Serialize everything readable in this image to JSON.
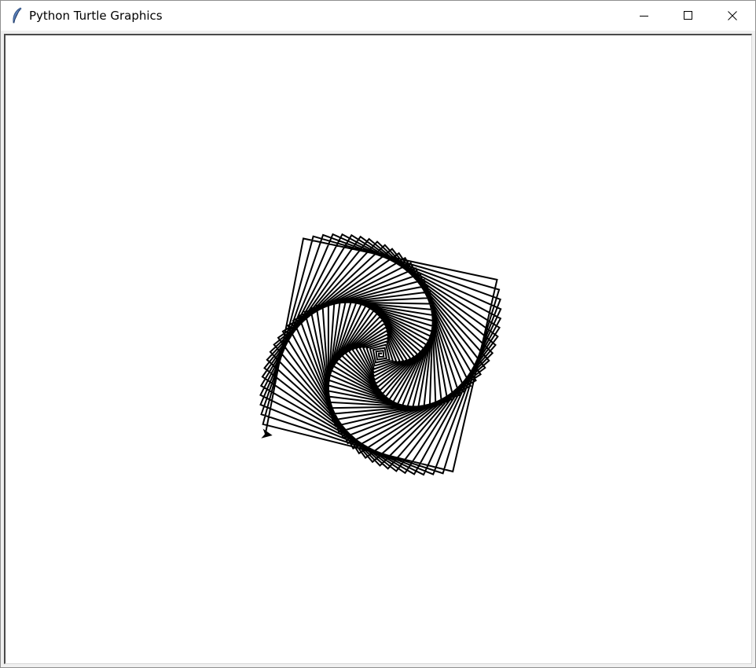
{
  "window": {
    "title": "Python Turtle Graphics",
    "app_icon": "feather-icon",
    "controls": {
      "minimize_icon": "minimize-icon",
      "maximize_icon": "maximize-icon",
      "close_icon": "close-icon"
    }
  },
  "canvas": {
    "background": "#ffffff",
    "pen_color": "#000000",
    "drawing": "square-spiral",
    "turtle_icon": "turtle-arrow-icon"
  }
}
